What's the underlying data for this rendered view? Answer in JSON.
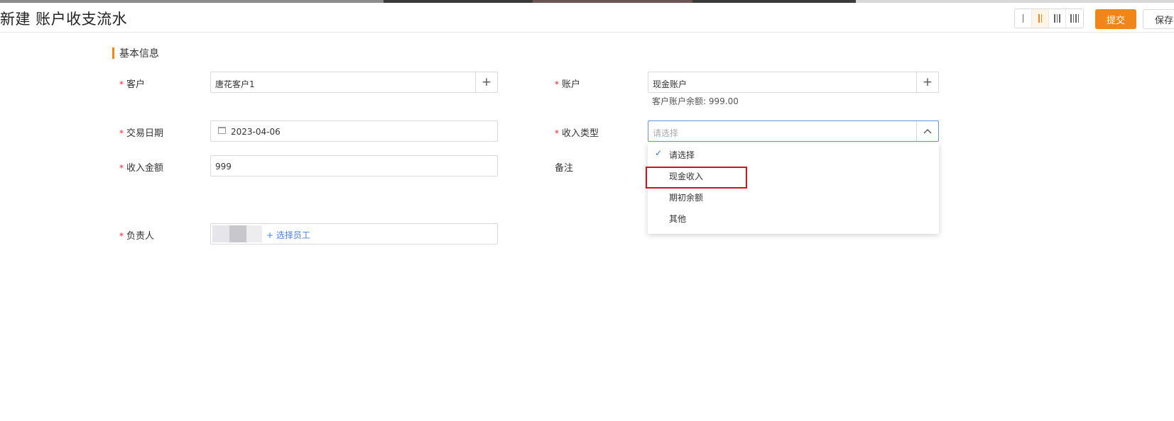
{
  "header": {
    "title": "新建 账户收支流水",
    "submit_label": "提交",
    "save_label": "保存"
  },
  "section": {
    "title": "基本信息"
  },
  "form": {
    "required_mark": "*",
    "customer": {
      "label": "客户",
      "value": "唐花客户1"
    },
    "account": {
      "label": "账户",
      "value": "现金账户",
      "balance_text": "客户账户余额: 999.00"
    },
    "trade_date": {
      "label": "交易日期",
      "value": "2023-04-06"
    },
    "income_type": {
      "label": "收入类型",
      "placeholder": "请选择"
    },
    "income_amount": {
      "label": "收入金额",
      "value": "999"
    },
    "remark": {
      "label": "备注"
    },
    "owner": {
      "label": "负责人",
      "select_link": "+ 选择员工"
    }
  },
  "dropdown": {
    "options": [
      "请选择",
      "现金收入",
      "期初余额",
      "其他"
    ],
    "selected_index": 0,
    "highlighted_index": 1
  },
  "colors": {
    "accent": "#f08519",
    "required": "#f5222d",
    "link": "#4a7fe0",
    "highlight": "#d4121d"
  }
}
